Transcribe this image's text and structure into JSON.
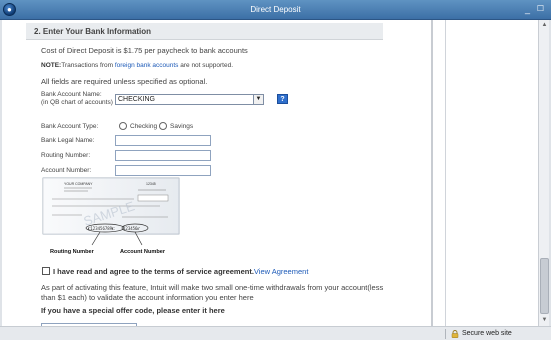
{
  "window": {
    "title": "Direct Deposit",
    "minimize_label": "_",
    "maximize_label": "☐"
  },
  "section": {
    "title": "2. Enter Your Bank Information",
    "cost_text": "Cost of Direct Deposit is $1.75 per paycheck to bank accounts",
    "note_label": "NOTE:",
    "note_before": "Transactions from ",
    "note_link": "foreign bank accounts",
    "note_after": " are not supported.",
    "required_text": "All fields are required unless specified as optional."
  },
  "form": {
    "bank_account_name_label_1": "Bank Account Name:",
    "bank_account_name_label_2": "(in QB chart of accounts)",
    "bank_account_name_value": "CHECKING",
    "help_label": "?",
    "account_type_label": "Bank Account Type:",
    "account_type_options": [
      "Checking",
      "Savings"
    ],
    "legal_name_label": "Bank Legal Name:",
    "legal_name_value": "",
    "routing_label": "Routing Number:",
    "routing_value": "",
    "account_number_label": "Account Number:",
    "account_number_value": ""
  },
  "check_image": {
    "watermark": "SAMPLE",
    "routing_caption": "Routing Number",
    "account_caption": "Account Number",
    "company_line": "YOUR COMPANY",
    "check_no": "12345"
  },
  "agreement": {
    "checkbox_label": "I have read and agree to the terms of service agreement.",
    "link_text": "View Agreement",
    "paragraph": "As part of activating this feature, Intuit will make two small one-time withdrawals from your account(less than $1 each) to validate the account information you enter here",
    "offer_label": "If you have a special offer code, please enter it here",
    "offer_code_value": ""
  },
  "status": {
    "secure_text": "Secure web site"
  },
  "colors": {
    "titlebar": "#4a7fb5",
    "link": "#1e5bb8",
    "help": "#2f6fcc"
  }
}
